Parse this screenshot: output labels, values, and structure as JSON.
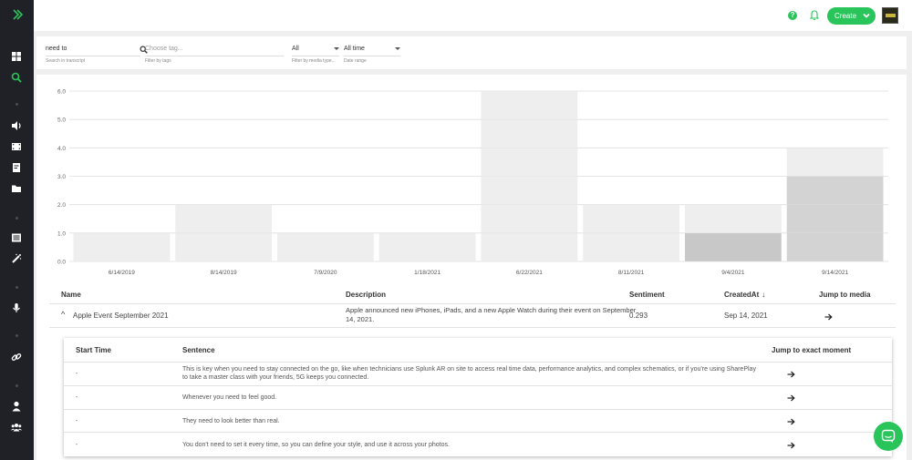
{
  "header": {
    "help_glyph": "?",
    "create_label": "Create"
  },
  "filters": {
    "search": {
      "value": "need to",
      "label": "Search in transcript"
    },
    "tag": {
      "placeholder": "Choose tag...",
      "label": "Filter by tags"
    },
    "media_type": {
      "value": "All",
      "label": "Filter by media type..."
    },
    "date_range": {
      "value": "All time",
      "label": "Date range"
    }
  },
  "chart_data": {
    "type": "bar",
    "categories": [
      "6/14/2019",
      "8/14/2019",
      "7/9/2020",
      "1/18/2021",
      "6/22/2021",
      "8/11/2021",
      "9/4/2021",
      "9/14/2021"
    ],
    "values": [
      1,
      2,
      1,
      1,
      6,
      2,
      2,
      4
    ],
    "highlight": [
      0,
      0,
      0,
      0,
      0,
      0,
      1,
      3
    ],
    "ylim": [
      0,
      6
    ],
    "yticks": [
      "0.0",
      "1.0",
      "2.0",
      "3.0",
      "4.0",
      "5.0",
      "6.0"
    ],
    "grid": true,
    "colors": {
      "bar": "#eeeeee",
      "highlight": "#d3d3d3",
      "highlight_dark": "#c8c8c8",
      "grid": "#e0e0e0"
    }
  },
  "media_table": {
    "headers": {
      "name": "Name",
      "description": "Description",
      "sentiment": "Sentiment",
      "created": "CreatedAt",
      "jump": "Jump to media"
    },
    "sort_glyph": "↓",
    "row": {
      "expand_glyph": "^",
      "name": "Apple Event September 2021",
      "description_line1": "Apple announced new iPhones, iPads, and a new Apple Watch during their event on September",
      "description_line2": "14, 2021.",
      "sentiment": "0.293",
      "created": "Sep 14, 2021"
    }
  },
  "sentence_table": {
    "headers": {
      "start": "Start Time",
      "sentence": "Sentence",
      "jump": "Jump to exact moment"
    },
    "rows": [
      {
        "start": "-",
        "line1": "This is key when you need to stay connected on the go, like when technicians use Splunk AR on site to access real time data, performance analytics, and complex schematics, or if you're using SharePlay",
        "line2": "to take a master class with your friends, 5G keeps you connected."
      },
      {
        "start": "-",
        "line1": "Whenever you need to feel good.",
        "line2": ""
      },
      {
        "start": "-",
        "line1": "They need to look better than real.",
        "line2": ""
      },
      {
        "start": "-",
        "line1": "You don't need to set it every time, so you can define your style, and use it across your photos.",
        "line2": ""
      }
    ]
  },
  "colors": {
    "accent": "#29c45a",
    "sidebar": "#1f2127",
    "sidebar_icon": "#ffffff",
    "sidebar_active": "#29c45a"
  }
}
